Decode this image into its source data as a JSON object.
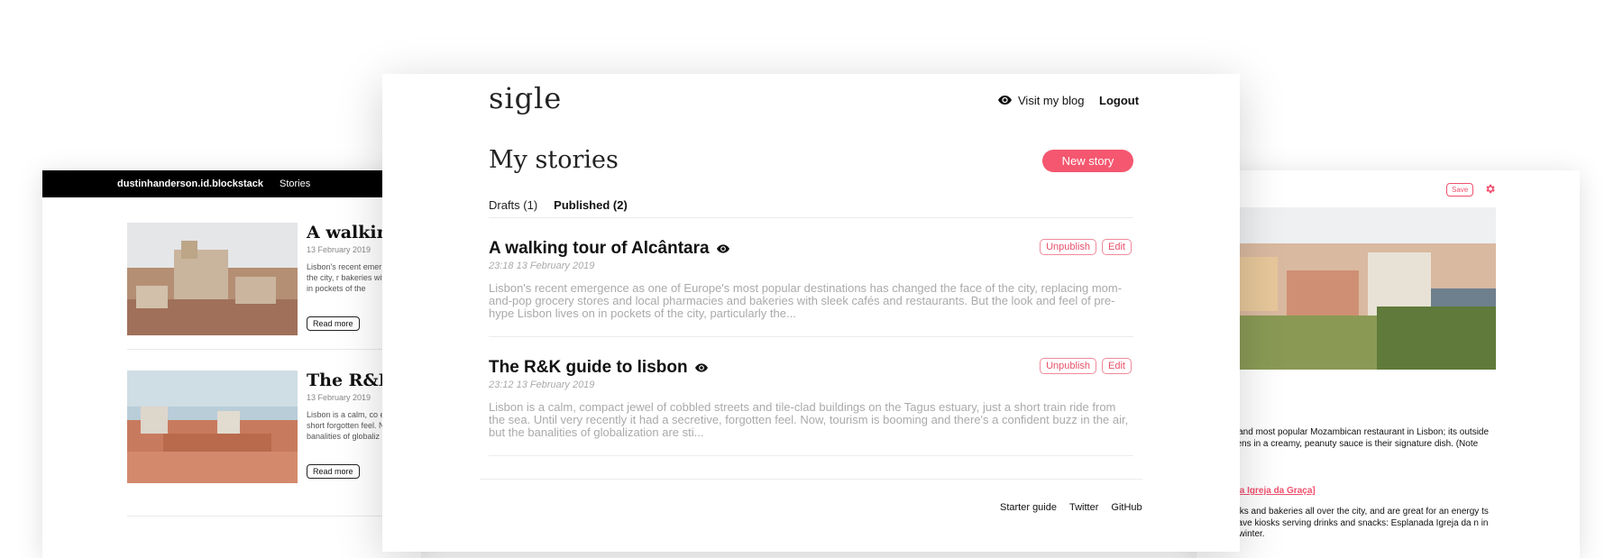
{
  "left_card": {
    "topbar": {
      "user": "dustinhanderson.id.blockstack",
      "stories": "Stories"
    },
    "items": [
      {
        "title": "A walking t",
        "date": "13 February 2019",
        "excerpt": "Lisbon's recent emer the face of the city, r bakeries with sleek c on in pockets of the",
        "read_more": "Read more"
      },
      {
        "title": "The R&K g",
        "date": "13 February 2019",
        "excerpt": "Lisbon is a calm, co estuary, just a short forgotten feel. Now, banalities of globaliz",
        "read_more": "Read more"
      }
    ]
  },
  "right_card": {
    "save_label": "Save",
    "paragraph_1": "est and most popular Mozambican restaurant in Lisbon; its outside greens in a creamy, peanuty sauce is their signature dish. (Note that",
    "link": "nada Igreja da Graça]",
    "paragraph_2": "kiosks and bakeries all over the city, and are great for an energy ts—have kiosks serving drinks and snacks: Esplanada Igreja da n in the winter."
  },
  "main": {
    "logo": "sigle",
    "nav": {
      "visit": "Visit my blog",
      "logout": "Logout"
    },
    "title": "My stories",
    "new_story": "New story",
    "tabs": {
      "drafts": "Drafts (1)",
      "published": "Published (2)"
    },
    "stories": [
      {
        "title": "A walking tour of Alcântara",
        "date": "23:18 13 February 2019",
        "excerpt": "Lisbon's recent emergence as one of Europe's most popular destinations has changed the face of the city, replacing mom-and-pop grocery stores and local pharmacies and bakeries with sleek cafés and restaurants. But the look and feel of pre-hype Lisbon lives on in pockets of the city, particularly the...",
        "unpublish": "Unpublish",
        "edit": "Edit"
      },
      {
        "title": "The R&K guide to lisbon",
        "date": "23:12 13 February 2019",
        "excerpt": "Lisbon is a calm, compact jewel of cobbled streets and tile-clad buildings on the Tagus estuary, just a short train ride from the sea. Until very recently it had a secretive, forgotten feel. Now, tourism is booming and there's a confident buzz in the air, but the banalities of globalization are sti...",
        "unpublish": "Unpublish",
        "edit": "Edit"
      }
    ],
    "footer": {
      "starter": "Starter guide",
      "twitter": "Twitter",
      "github": "GitHub"
    }
  },
  "colors": {
    "accent": "#f4576f",
    "text": "#111111",
    "muted": "#aaaaaa"
  },
  "icons": {
    "visibility": "eye-icon",
    "settings": "gear-icon"
  }
}
